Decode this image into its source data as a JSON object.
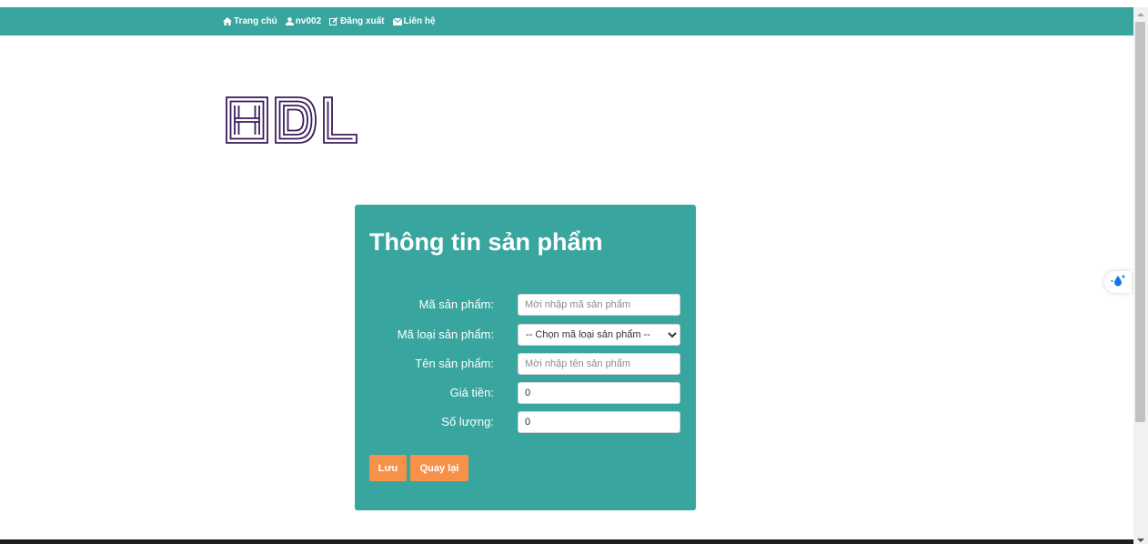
{
  "nav": {
    "items": [
      {
        "label": "Trang chủ",
        "icon": "home-icon"
      },
      {
        "label": "nv002",
        "icon": "user-icon"
      },
      {
        "label": "Đăng xuất",
        "icon": "edit-icon"
      },
      {
        "label": "Liên hệ",
        "icon": "envelope-icon"
      }
    ]
  },
  "logo": {
    "text": "HDL",
    "color": "#3b1c5a"
  },
  "form": {
    "title": "Thông tin sản phẩm",
    "fields": [
      {
        "label": "Mã sản phẩm:",
        "type": "text",
        "placeholder": "Mời nhập mã sản phẩm",
        "value": ""
      },
      {
        "label": "Mã loại sản phẩm:",
        "type": "select",
        "value": "-- Chọn mã loại sản phẩm --"
      },
      {
        "label": "Tên sản phẩm:",
        "type": "text",
        "placeholder": "Mời nhập tên sản phẩm",
        "value": ""
      },
      {
        "label": "Giá tiền:",
        "type": "text",
        "value": "0"
      },
      {
        "label": "Số lượng:",
        "type": "text",
        "value": "0"
      }
    ],
    "save_label": "Lưu",
    "back_label": "Quay lại"
  },
  "colors": {
    "primary": "#38a59e",
    "button": "#f7914a",
    "logo": "#3b1c5a"
  }
}
